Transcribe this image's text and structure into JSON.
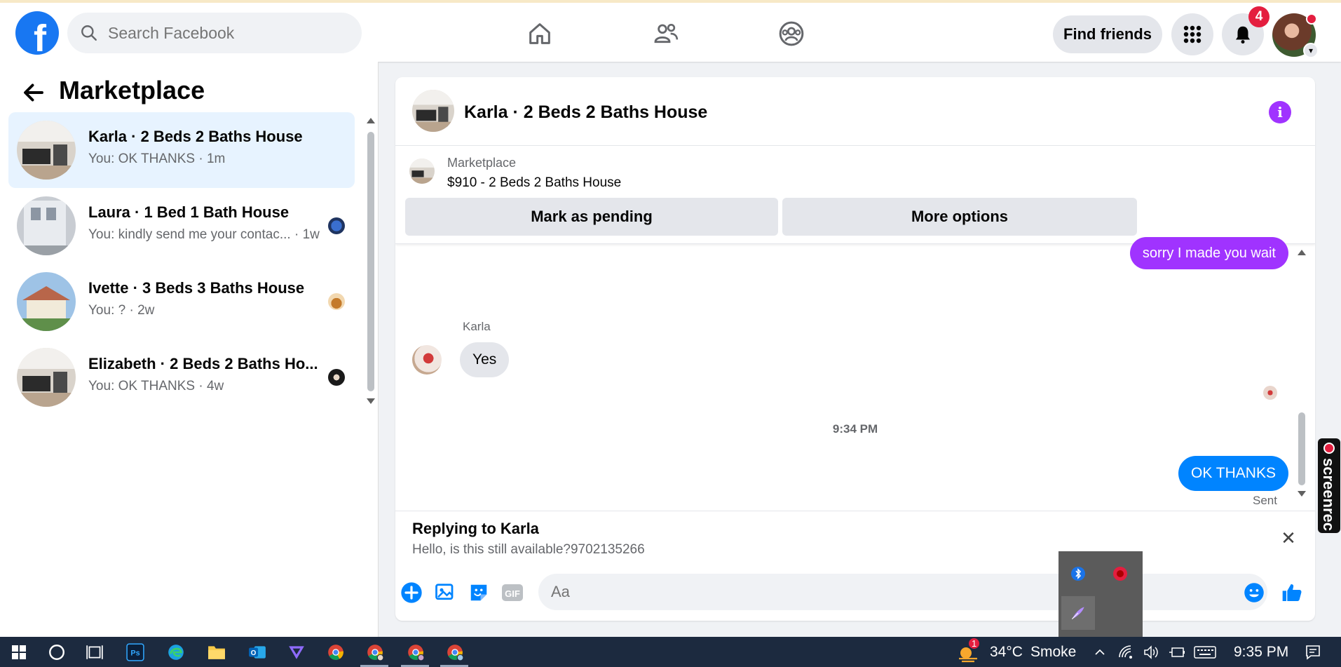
{
  "topbar": {
    "search_placeholder": "Search Facebook",
    "find_friends_label": "Find friends",
    "notification_count": "4",
    "logo_letter": "f"
  },
  "left": {
    "title": "Marketplace",
    "conversations": [
      {
        "title": "Karla · 2 Beds 2 Baths House",
        "snippet": "You: OK THANKS · 1m",
        "active": true
      },
      {
        "title": "Laura · 1 Bed 1 Bath House",
        "snippet": "You: kindly send me your contac... · 1w",
        "active": false
      },
      {
        "title": "Ivette · 3 Beds 3 Baths House",
        "snippet": "You: ? · 2w",
        "active": false
      },
      {
        "title": "Elizabeth · 2 Beds 2 Baths Ho...",
        "snippet": "You: OK THANKS · 4w",
        "active": false
      }
    ]
  },
  "chat": {
    "header_name": "Karla · 2 Beds 2 Baths House",
    "listing_source": "Marketplace",
    "listing_price_title": "$910 - 2 Beds 2 Baths House",
    "mark_pending_label": "Mark as pending",
    "more_options_label": "More options",
    "messages": {
      "partial_out": "sorry I made you wait",
      "sender_name": "Karla",
      "incoming": "Yes",
      "time": "9:34 PM",
      "outgoing": "OK THANKS",
      "status": "Sent"
    },
    "reply": {
      "title": "Replying to Karla",
      "text": "Hello, is this still available?9702135266"
    },
    "composer_placeholder": "Aa",
    "info_glyph": "i",
    "close_glyph": "✕"
  },
  "screenrec_label": "screenrec",
  "taskbar": {
    "weather_temp": "34°C",
    "weather_desc": "Smoke",
    "weather_badge": "1",
    "clock": "9:35 PM"
  },
  "colors": {
    "facebook_blue": "#1877f2",
    "messenger_purple": "#a033ff",
    "outgoing_blue": "#0084ff",
    "active_row": "#e7f3ff"
  }
}
